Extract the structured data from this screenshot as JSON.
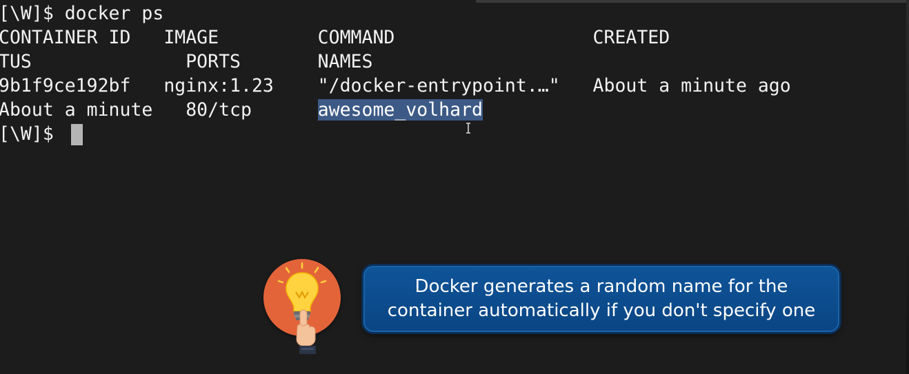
{
  "terminal": {
    "lines": [
      "[\\W]$ docker ps",
      "CONTAINER ID   IMAGE         COMMAND                  CREATED",
      "TUS              PORTS       NAMES",
      "9b1f9ce192bf   nginx:1.23    \"/docker-entrypoint.…\"   About a minute ago",
      "About a minute   80/tcp      "
    ],
    "selected_name": "awesome_volhard",
    "prompt": "[\\W]$ "
  },
  "tip": {
    "line1": "Docker generates a random name for the",
    "line2": "container automatically if you don't specify one"
  },
  "colors": {
    "terminal_bg": "#1c1c1c",
    "selection": "#3d5a86",
    "tip_box": "#0f5498",
    "tip_circle": "#e4643a"
  },
  "icons": [
    "text-cursor-icon",
    "lightbulb-icon",
    "pointing-hand-icon"
  ]
}
